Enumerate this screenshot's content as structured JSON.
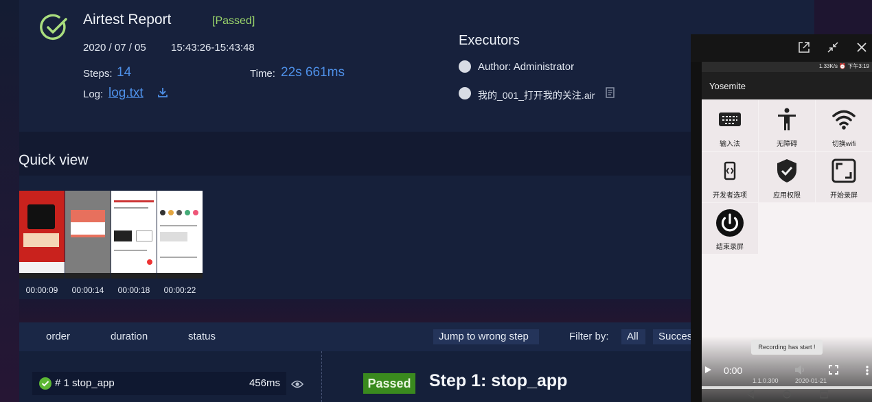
{
  "report": {
    "title": "Airtest Report",
    "result": "[Passed]",
    "date": "2020 / 07 / 05",
    "time_range": "15:43:26-15:43:48",
    "steps_label": "Steps:",
    "steps_value": "14",
    "time_label": "Time:",
    "time_value": "22s 661ms",
    "log_label": "Log:",
    "log_link": "log.txt"
  },
  "executors": {
    "heading": "Executors",
    "items": [
      "Author: Administrator",
      "我的_001_打开我的关注.air"
    ]
  },
  "quick_view": {
    "heading": "Quick view",
    "thumbnails": [
      "00:00:09",
      "00:00:14",
      "00:00:18",
      "00:00:22"
    ]
  },
  "steps_header": {
    "columns": [
      "order",
      "duration",
      "status"
    ],
    "jump_button": "Jump to wrong step",
    "filter_label": "Filter by:",
    "filters": [
      "All",
      "Succes"
    ]
  },
  "step_list": [
    {
      "label": "# 1 stop_app",
      "duration": "456ms"
    }
  ],
  "step_detail": {
    "status": "Passed",
    "title": "Step 1: stop_app"
  },
  "phone": {
    "status_bar": "1.33K/s ⏰ 下午3:19",
    "app_title": "Yosemite",
    "tiles": [
      "输入法",
      "无障碍",
      "切换wifi",
      "开发者选项",
      "应用权限",
      "开始录屏",
      "结束录屏"
    ],
    "toast": "Recording has start !",
    "video_time": "0:00",
    "footer_version": "1.1.0.300",
    "footer_date": "2020-01-21"
  },
  "colors": {
    "accent_blue": "#4e90e8",
    "passed_green": "#9bd66b",
    "badge_green": "#3a8a1e"
  }
}
